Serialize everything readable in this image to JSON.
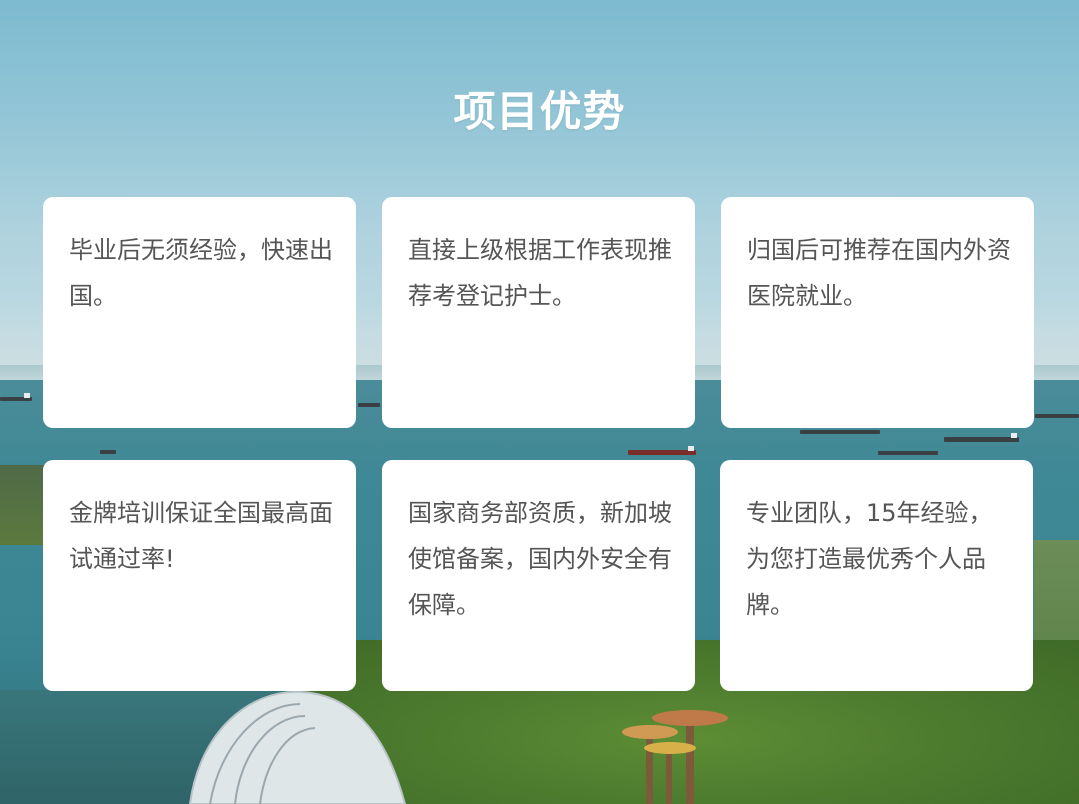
{
  "section": {
    "title": "项目优势"
  },
  "cards": [
    {
      "text": "毕业后无须经验，快速出国。"
    },
    {
      "text": "直接上级根据工作表现推荐考登记护士。"
    },
    {
      "text": "归国后可推荐在国内外资医院就业。"
    },
    {
      "text": "金牌培训保证全国最高面试通过率!"
    },
    {
      "text": "国家商务部资质，新加坡使馆备案，国内外安全有保障。"
    },
    {
      "text": "专业团队，15年经验，为您打造最优秀个人品牌。"
    }
  ],
  "colors": {
    "title": "#ffffff",
    "card_bg": "#ffffff",
    "card_text": "#555555",
    "sky": "#8fc3d5",
    "sea": "#3d8794"
  }
}
